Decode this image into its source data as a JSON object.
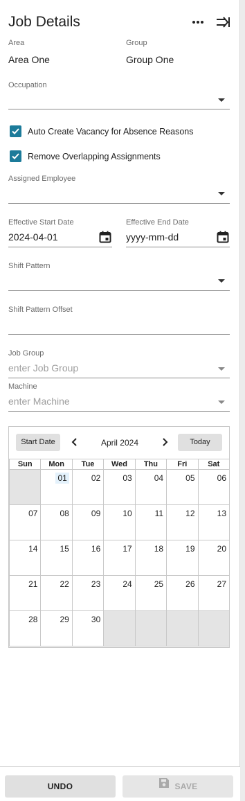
{
  "header": {
    "title": "Job Details"
  },
  "area": {
    "label": "Area",
    "value": "Area One"
  },
  "group": {
    "label": "Group",
    "value": "Group One"
  },
  "occupation": {
    "label": "Occupation",
    "value": ""
  },
  "checkboxes": [
    {
      "label": "Auto Create Vacancy for Absence Reasons",
      "checked": true
    },
    {
      "label": "Remove Overlapping Assignments",
      "checked": true
    }
  ],
  "assigned_employee": {
    "label": "Assigned Employee",
    "value": ""
  },
  "effective_start": {
    "label": "Effective Start Date",
    "value": "2024-04-01"
  },
  "effective_end": {
    "label": "Effective End Date",
    "placeholder": "yyyy-mm-dd"
  },
  "shift_pattern": {
    "label": "Shift Pattern",
    "value": ""
  },
  "shift_pattern_offset": {
    "label": "Shift Pattern Offset",
    "value": ""
  },
  "job_group": {
    "label": "Job Group",
    "placeholder": "enter Job Group"
  },
  "machine": {
    "label": "Machine",
    "placeholder": "enter Machine"
  },
  "calendar": {
    "start_date_label": "Start Date",
    "month_label": "April 2024",
    "today_label": "Today",
    "weekdays": [
      "Sun",
      "Mon",
      "Tue",
      "Wed",
      "Thu",
      "Fri",
      "Sat"
    ],
    "weeks": [
      [
        "",
        "01",
        "02",
        "03",
        "04",
        "05",
        "06"
      ],
      [
        "07",
        "08",
        "09",
        "10",
        "11",
        "12",
        "13"
      ],
      [
        "14",
        "15",
        "16",
        "17",
        "18",
        "19",
        "20"
      ],
      [
        "21",
        "22",
        "23",
        "24",
        "25",
        "26",
        "27"
      ],
      [
        "28",
        "29",
        "30",
        "",
        "",
        "",
        ""
      ]
    ],
    "highlighted_day": "01"
  },
  "footer": {
    "undo_label": "UNDO",
    "save_label": "SAVE"
  },
  "colors": {
    "checkbox": "#1c7b9a",
    "highlight": "#e3f1fb"
  }
}
